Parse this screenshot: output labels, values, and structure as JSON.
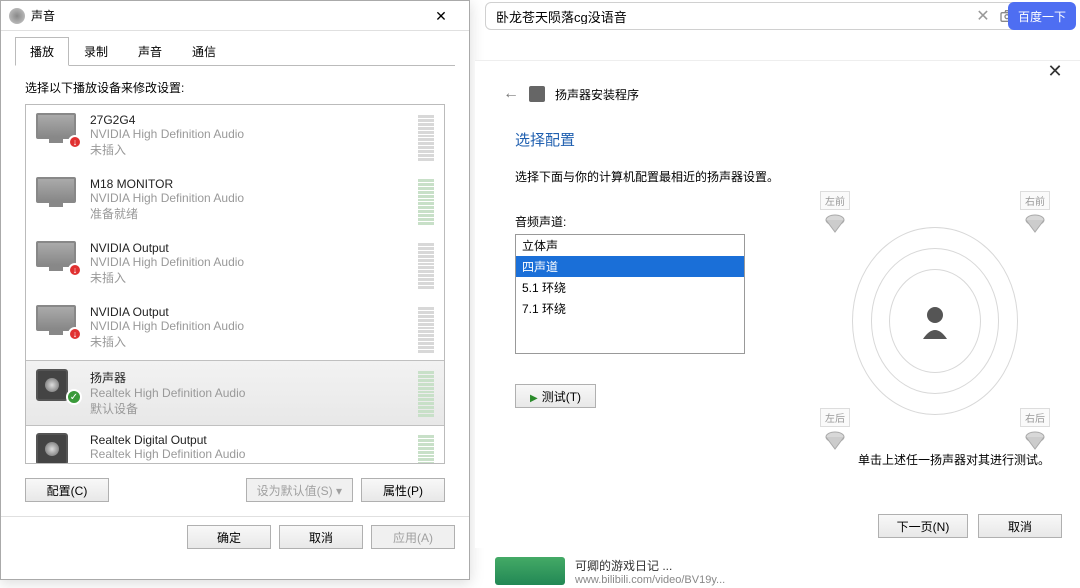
{
  "search": {
    "value": "卧龙苍天陨落cg没语音",
    "button": "百度一下"
  },
  "sound_dialog": {
    "title": "声音",
    "tabs": [
      "播放",
      "录制",
      "声音",
      "通信"
    ],
    "active_tab": 0,
    "instruction": "选择以下播放设备来修改设置:",
    "devices": [
      {
        "name": "27G2G4",
        "desc": "NVIDIA High Definition Audio",
        "status": "未插入",
        "kind": "monitor",
        "badge": "down",
        "level": "dim"
      },
      {
        "name": "M18  MONITOR",
        "desc": "NVIDIA High Definition Audio",
        "status": "准备就绪",
        "kind": "monitor",
        "badge": "",
        "level": "on"
      },
      {
        "name": "NVIDIA Output",
        "desc": "NVIDIA High Definition Audio",
        "status": "未插入",
        "kind": "monitor",
        "badge": "down",
        "level": "dim"
      },
      {
        "name": "NVIDIA Output",
        "desc": "NVIDIA High Definition Audio",
        "status": "未插入",
        "kind": "monitor",
        "badge": "down",
        "level": "dim"
      },
      {
        "name": "扬声器",
        "desc": "Realtek High Definition Audio",
        "status": "默认设备",
        "kind": "speaker",
        "badge": "check",
        "level": "on",
        "selected": true
      },
      {
        "name": "Realtek Digital Output",
        "desc": "Realtek High Definition Audio",
        "status": "",
        "kind": "speaker",
        "badge": "",
        "level": "on"
      }
    ],
    "buttons": {
      "configure": "配置(C)",
      "set_default": "设为默认值(S)",
      "properties": "属性(P)"
    },
    "footer": {
      "ok": "确定",
      "cancel": "取消",
      "apply": "应用(A)"
    }
  },
  "wizard": {
    "title": "扬声器安装程序",
    "heading": "选择配置",
    "desc": "选择下面与你的计算机配置最相近的扬声器设置。",
    "channel_label": "音频声道:",
    "channels": [
      "立体声",
      "四声道",
      "5.1 环绕",
      "7.1 环绕"
    ],
    "selected_channel": 1,
    "test": "测试(T)",
    "speakers": {
      "fl": "左前",
      "fr": "右前",
      "rl": "左后",
      "rr": "右后"
    },
    "hint": "单击上述任一扬声器对其进行测试。",
    "next": "下一页(N)",
    "cancel": "取消"
  },
  "peek": {
    "title": "可卿的游戏日记 ...",
    "url": "www.bilibili.com/video/BV19y..."
  }
}
